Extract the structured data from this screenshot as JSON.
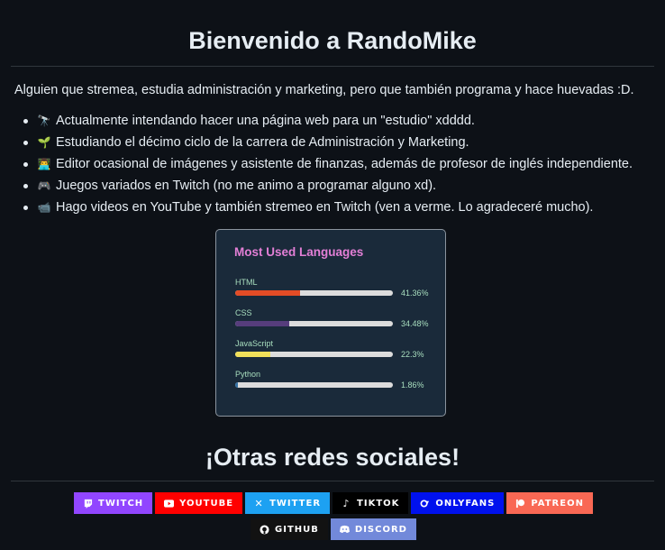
{
  "header": {
    "title": "Bienvenido a RandoMike"
  },
  "intro": "Alguien que stremea, estudia administración y marketing, pero que también programa y hace huevadas :D.",
  "facts": [
    {
      "icon": "telescope-icon",
      "glyph": "🔭",
      "text": "Actualmente intendando hacer una página web para un \"estudio\" xdddd."
    },
    {
      "icon": "seedling-icon",
      "glyph": "🌱",
      "text": "Estudiando el décimo ciclo de la carrera de Administración y Marketing."
    },
    {
      "icon": "laptop-person-icon",
      "glyph": "👨‍💻",
      "text": "Editor ocasional de imágenes y asistente de finanzas, además de profesor de inglés independiente."
    },
    {
      "icon": "gamepad-icon",
      "glyph": "🎮",
      "text": "Juegos variados en Twitch (no me animo a programar alguno xd)."
    },
    {
      "icon": "video-camera-icon",
      "glyph": "📹",
      "text": "Hago videos en YouTube y también stremeo en Twitch (ven a verme. Lo agradeceré mucho)."
    }
  ],
  "languages_card": {
    "title": "Most Used Languages",
    "languages": [
      {
        "name": "HTML",
        "percent": 41.36,
        "label": "41.36%",
        "color": "#e34c26"
      },
      {
        "name": "CSS",
        "percent": 34.48,
        "label": "34.48%",
        "color": "#563d7c"
      },
      {
        "name": "JavaScript",
        "percent": 22.3,
        "label": "22.3%",
        "color": "#f1e05a"
      },
      {
        "name": "Python",
        "percent": 1.86,
        "label": "1.86%",
        "color": "#3572A5"
      }
    ]
  },
  "socials": {
    "title": "¡Otras redes sociales!",
    "badges": [
      {
        "label": "TWITCH",
        "icon": "twitch-icon",
        "color": "#9146ff"
      },
      {
        "label": "YOUTUBE",
        "icon": "youtube-icon",
        "color": "#ff0000"
      },
      {
        "label": "TWITTER",
        "icon": "twitter-icon",
        "color": "#1da1f2"
      },
      {
        "label": "TIKTOK",
        "icon": "tiktok-icon",
        "color": "#000000"
      },
      {
        "label": "ONLYFANS",
        "icon": "onlyfans-icon",
        "color": "#0011ee"
      },
      {
        "label": "PATREON",
        "icon": "patreon-icon",
        "color": "#f96854"
      },
      {
        "label": "GITHUB",
        "icon": "github-icon",
        "color": "#121212"
      },
      {
        "label": "DISCORD",
        "icon": "discord-icon",
        "color": "#7289da"
      }
    ]
  }
}
